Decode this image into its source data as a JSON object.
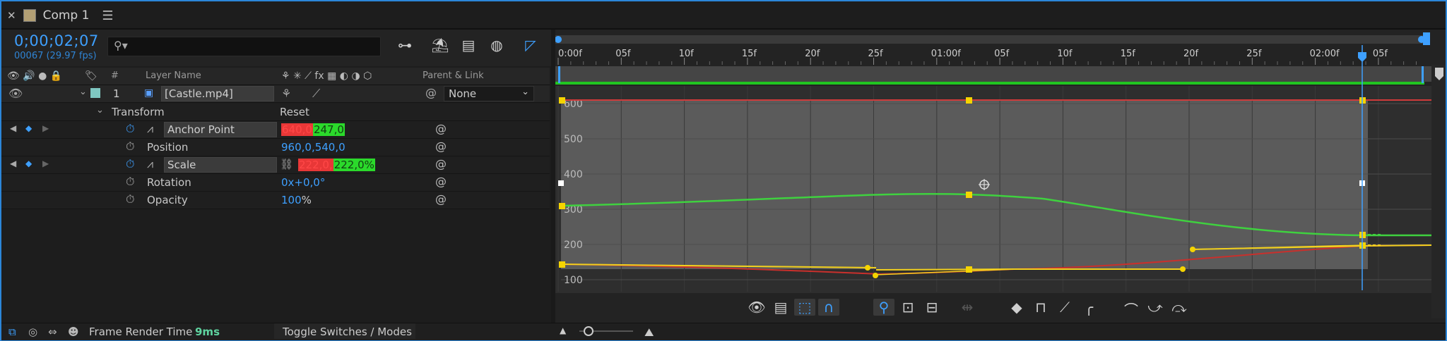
{
  "tab": {
    "title": "Comp 1"
  },
  "time": {
    "timecode": "0;00;02;07",
    "frame_info": "00067 (29.97 fps)"
  },
  "search": {
    "placeholder": ""
  },
  "columns": {
    "number": "#",
    "layer_name": "Layer Name",
    "parent_link": "Parent & Link"
  },
  "layer": {
    "number": "1",
    "name": "[Castle.mp4]",
    "parent": "None",
    "label_color": "#7fc7c1"
  },
  "transform": {
    "label": "Transform",
    "reset": "Reset"
  },
  "properties": [
    {
      "name": "Anchor Point",
      "v1": "640,0",
      "v2": "247,0",
      "sep": "",
      "animated": true
    },
    {
      "name": "Position",
      "value": "960,0,540,0",
      "animated": false
    },
    {
      "name": "Scale",
      "v1": "222,0,",
      "v2": "222,0%",
      "animated": true
    },
    {
      "name": "Rotation",
      "value": "0x+0,0°",
      "animated": false
    },
    {
      "name": "Opacity",
      "value": "100",
      "unit": "%",
      "animated": false
    }
  ],
  "ruler": {
    "labels": [
      "0:00f",
      "05f",
      "10f",
      "15f",
      "20f",
      "25f",
      "01:00f",
      "05f",
      "10f",
      "15f",
      "20f",
      "25f",
      "02:00f",
      "05f"
    ]
  },
  "graph_axis": {
    "labels": [
      "600",
      "500",
      "400",
      "300",
      "200",
      "100"
    ]
  },
  "bottom": {
    "frame_render_label": "Frame Render Time",
    "frame_render_value": "9ms",
    "toggle_label": "Toggle Switches / Modes"
  },
  "colors": {
    "accent": "#3ea0ff",
    "curve_red": "#d03a3a",
    "curve_green": "#3fd13f",
    "curve_yellow": "#f2d01e",
    "keyframe": "#f5d400",
    "frame_render_value": "#5fd4a0"
  }
}
